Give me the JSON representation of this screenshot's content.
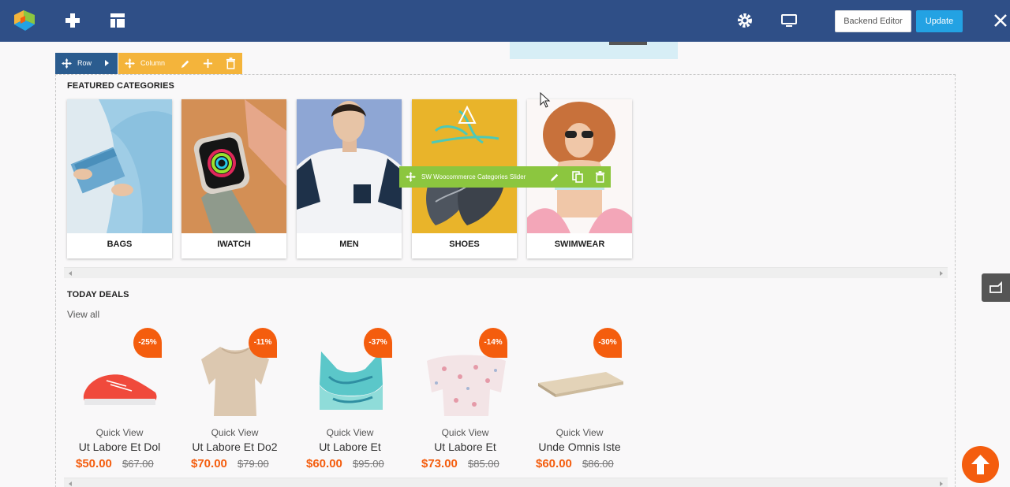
{
  "toolbar": {
    "backend_editor_label": "Backend Editor",
    "update_label": "Update",
    "icons": [
      "add-element-icon",
      "templates-icon",
      "settings-icon",
      "responsive-icon",
      "close-icon"
    ]
  },
  "builder": {
    "row_label": "Row",
    "column_label": "Column",
    "element_label": "SW Woocommerce Categories Slider"
  },
  "featured": {
    "title": "FEATURED CATEGORIES",
    "categories": [
      {
        "label": "BAGS"
      },
      {
        "label": "IWATCH"
      },
      {
        "label": "MEN"
      },
      {
        "label": "SHOES"
      },
      {
        "label": "SWIMWEAR"
      }
    ]
  },
  "deals": {
    "title": "TODAY DEALS",
    "view_all": "View all",
    "quick_view": "Quick View",
    "items": [
      {
        "badge": "-25%",
        "name": "Ut Labore Et Dol",
        "price": "$50.00",
        "old_price": "$67.00"
      },
      {
        "badge": "-11%",
        "name": "Ut Labore Et Do2",
        "price": "$70.00",
        "old_price": "$79.00"
      },
      {
        "badge": "-37%",
        "name": "Ut Labore Et",
        "price": "$60.00",
        "old_price": "$95.00"
      },
      {
        "badge": "-14%",
        "name": "Ut Labore Et",
        "price": "$73.00",
        "old_price": "$85.00"
      },
      {
        "badge": "-30%",
        "name": "Unde Omnis Iste",
        "price": "$60.00",
        "old_price": "$86.00"
      }
    ]
  },
  "colors": {
    "topbar": "#2f4f87",
    "update": "#23a2e3",
    "row": "#2b5c8f",
    "column": "#f4b43b",
    "element": "#8cc63f",
    "accent": "#f45d0e"
  }
}
